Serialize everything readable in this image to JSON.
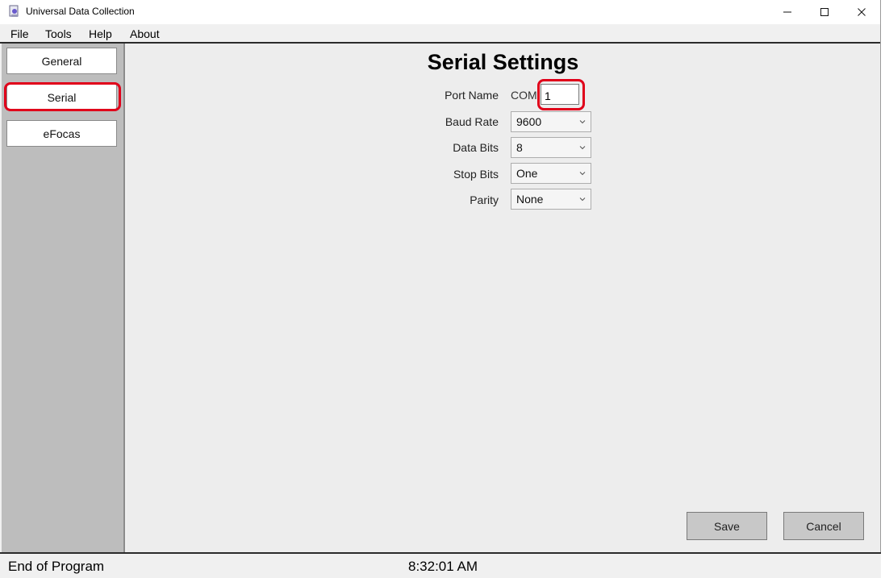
{
  "window": {
    "title": "Universal Data Collection"
  },
  "menu": {
    "items": [
      "File",
      "Tools",
      "Help",
      "About"
    ]
  },
  "sidebar": {
    "items": [
      {
        "label": "General"
      },
      {
        "label": "Serial"
      },
      {
        "label": "eFocas"
      }
    ]
  },
  "serial": {
    "title": "Serial Settings",
    "port_name_label": "Port Name",
    "com_prefix": "COM",
    "port_value": "1",
    "baud_rate_label": "Baud Rate",
    "baud_rate_value": "9600",
    "data_bits_label": "Data Bits",
    "data_bits_value": "8",
    "stop_bits_label": "Stop Bits",
    "stop_bits_value": "One",
    "parity_label": "Parity",
    "parity_value": "None"
  },
  "buttons": {
    "save": "Save",
    "cancel": "Cancel"
  },
  "status": {
    "message": "End of Program",
    "time": "8:32:01 AM"
  },
  "colors": {
    "highlight": "#e0001a",
    "sidebar_bg": "#bdbdbd",
    "content_bg": "#ededed"
  }
}
